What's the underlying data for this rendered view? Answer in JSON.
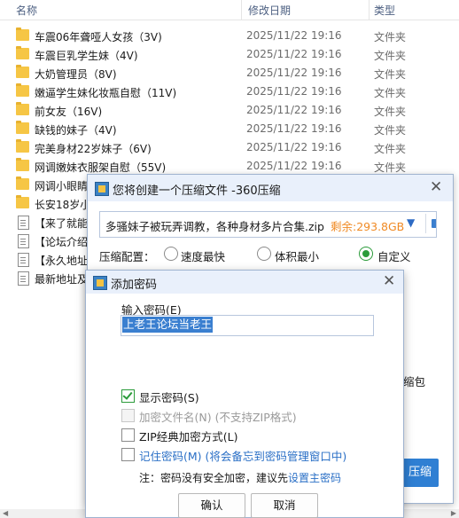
{
  "explorer": {
    "columns": {
      "name": "名称",
      "date": "修改日期",
      "type": "类型"
    },
    "rows": [
      {
        "icon": "folder-icon",
        "name": "车震06年聋哑人女孩（3V)",
        "date": "2025/11/22 19:16",
        "type": "文件夹"
      },
      {
        "icon": "folder-icon",
        "name": "车震巨乳学生妹（4V)",
        "date": "2025/11/22 19:16",
        "type": "文件夹"
      },
      {
        "icon": "folder-icon",
        "name": "大奶管理员（8V)",
        "date": "2025/11/22 19:16",
        "type": "文件夹"
      },
      {
        "icon": "folder-icon",
        "name": "嫩逼学生妹化妆瓶自慰（11V)",
        "date": "2025/11/22 19:16",
        "type": "文件夹"
      },
      {
        "icon": "folder-icon",
        "name": "前女友（16V)",
        "date": "2025/11/22 19:16",
        "type": "文件夹"
      },
      {
        "icon": "folder-icon",
        "name": "缺钱的妹子（4V)",
        "date": "2025/11/22 19:16",
        "type": "文件夹"
      },
      {
        "icon": "folder-icon",
        "name": "完美身材22岁妹子（6V)",
        "date": "2025/11/22 19:16",
        "type": "文件夹"
      },
      {
        "icon": "folder-icon",
        "name": "网调嫩妹衣服架自慰（55V)",
        "date": "2025/11/22 19:16",
        "type": "文件夹"
      },
      {
        "icon": "folder-icon",
        "name": "网调小眼睛",
        "date": "",
        "type": ""
      },
      {
        "icon": "folder-icon",
        "name": "长安18岁小",
        "date": "",
        "type": ""
      },
      {
        "icon": "document-icon",
        "name": "【来了就能",
        "date": "",
        "type": ""
      },
      {
        "icon": "document-icon",
        "name": "【论坛介绍",
        "date": "",
        "type": ""
      },
      {
        "icon": "document-icon",
        "name": "【永久地址",
        "date": "",
        "type": ""
      },
      {
        "icon": "document-icon",
        "name": "最新地址及",
        "date": "",
        "type": ""
      }
    ]
  },
  "compress_dialog": {
    "title": "您将创建一个压缩文件 -360压缩",
    "path_text": "多骚妹子被玩弄调教，各种身材多片合集.zip",
    "free_space": "剩余:293.8GB",
    "config_label": "压缩配置：",
    "options": [
      {
        "label": "速度最快",
        "selected": false
      },
      {
        "label": "体积最小",
        "selected": false
      },
      {
        "label": "自定义",
        "selected": true
      }
    ],
    "partial_text": "缩包",
    "compress_button": "压缩"
  },
  "password_dialog": {
    "title": "添加密码",
    "input_label": "输入密码(E)",
    "password_value": "上老王论坛当老王",
    "checkboxes": [
      {
        "label": "显示密码(S)",
        "checked": true,
        "enabled": true
      },
      {
        "label": "加密文件名(N) (不支持ZIP格式)",
        "checked": false,
        "enabled": false
      },
      {
        "label": "ZIP经典加密方式(L)",
        "checked": false,
        "enabled": true
      },
      {
        "label": "记住密码(M) (将会备忘到密码管理窗口中)",
        "checked": false,
        "enabled": true
      }
    ],
    "note_prefix": "注：密码没有安全加密，建议先",
    "note_link": "设置主密码",
    "ok_button": "确认",
    "cancel_button": "取消"
  },
  "colors": {
    "accent": "#2f7fd3",
    "check_green": "#2b9b3a",
    "free_space_orange": "#f08a24",
    "link_blue": "#2a6fc6"
  }
}
